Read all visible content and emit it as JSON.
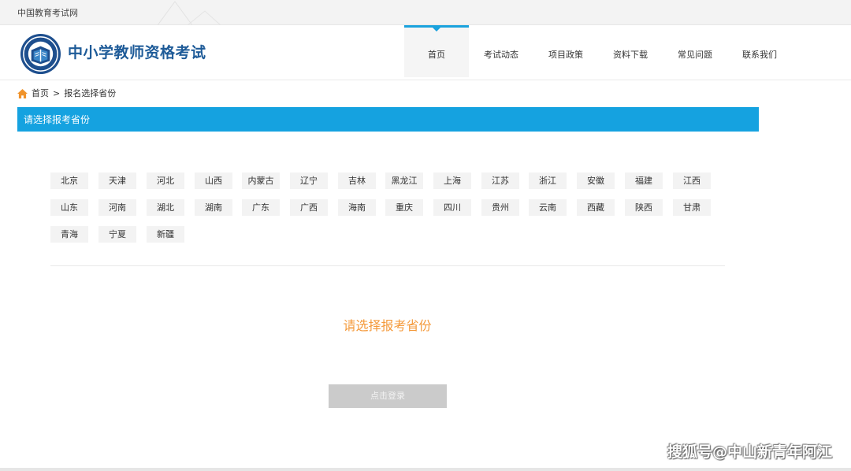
{
  "topbar": {
    "site_name": "中国教育考试网"
  },
  "header": {
    "title": "中小学教师资格考试",
    "nav": [
      {
        "label": "首页",
        "active": true
      },
      {
        "label": "考试动态",
        "active": false
      },
      {
        "label": "项目政策",
        "active": false
      },
      {
        "label": "资料下载",
        "active": false
      },
      {
        "label": "常见问题",
        "active": false
      },
      {
        "label": "联系我们",
        "active": false
      }
    ]
  },
  "breadcrumb": {
    "home": "首页",
    "separator": ">",
    "current": "报名选择省份"
  },
  "section": {
    "title": "请选择报考省份"
  },
  "provinces": [
    [
      "北京",
      "天津",
      "河北",
      "山西",
      "内蒙古",
      "辽宁",
      "吉林",
      "黑龙江",
      "上海",
      "江苏",
      "浙江",
      "安徽",
      "福建",
      "江西"
    ],
    [
      "山东",
      "河南",
      "湖北",
      "湖南",
      "广东",
      "广西",
      "海南",
      "重庆",
      "四川",
      "贵州",
      "云南",
      "西藏",
      "陕西",
      "甘肃"
    ],
    [
      "青海",
      "宁夏",
      "新疆"
    ]
  ],
  "prompt": "请选择报考省份",
  "login_button": "点击登录",
  "watermark": "搜狐号@中山新青年阿江",
  "colors": {
    "accent": "#15a2e0",
    "brand": "#1e5b98",
    "prompt": "#f4993a",
    "disabled": "#cbcbcb"
  }
}
